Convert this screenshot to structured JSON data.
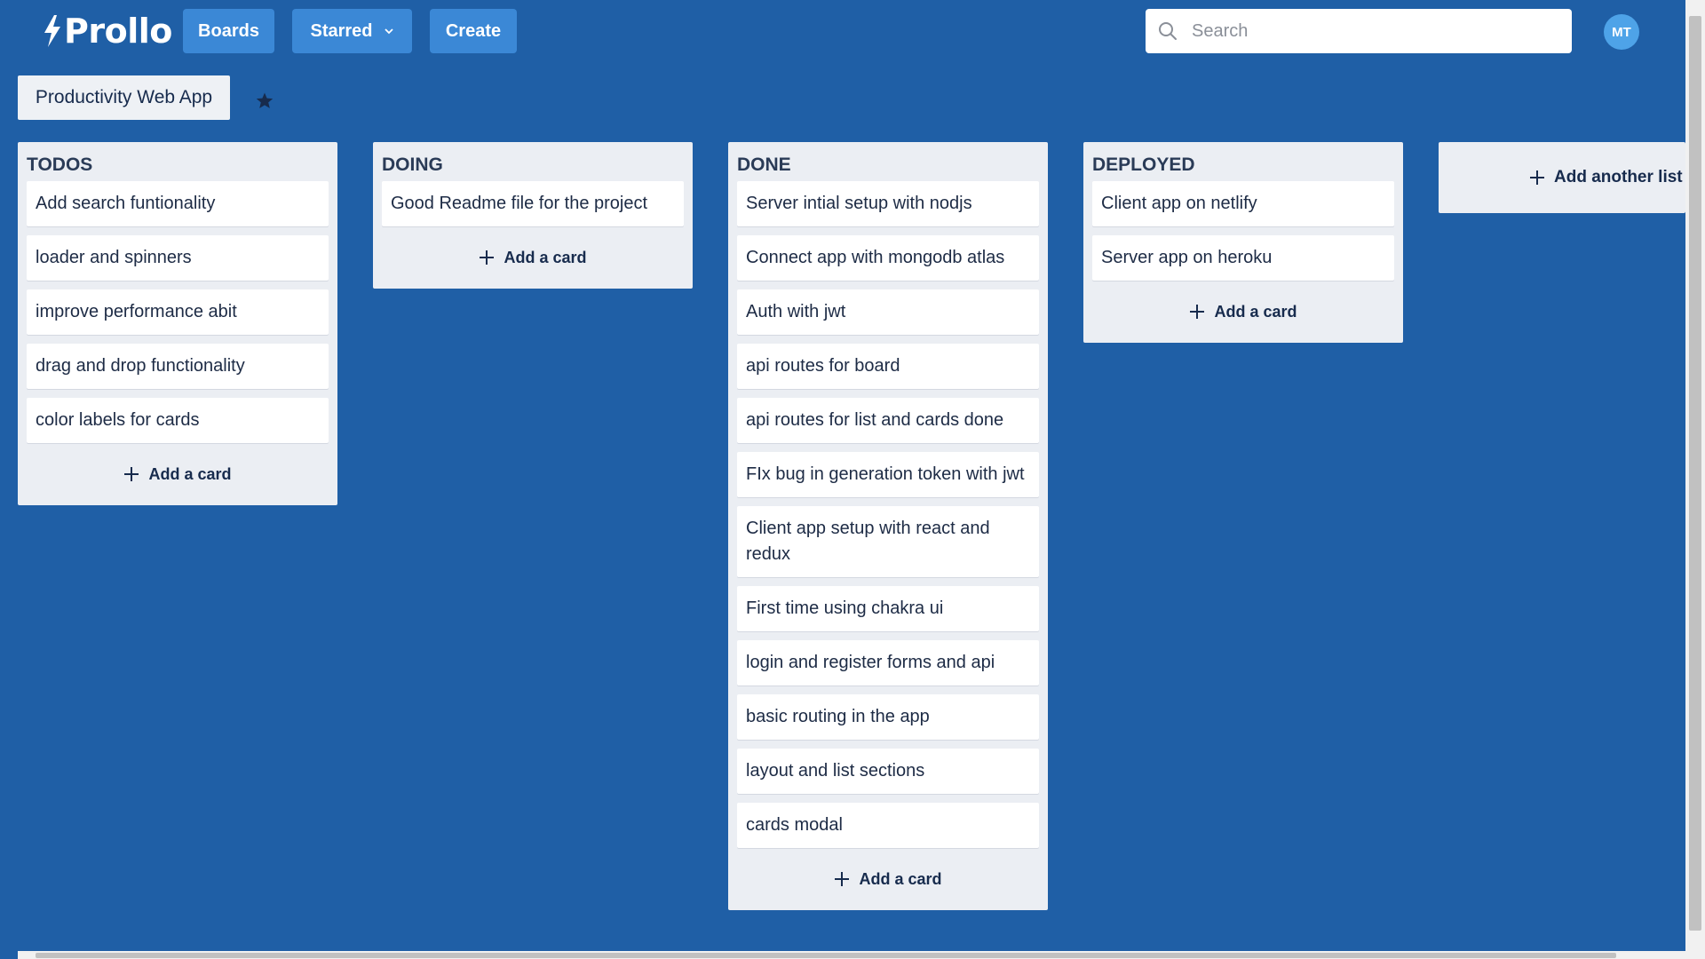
{
  "header": {
    "logo_text": "Prollo",
    "nav": {
      "boards_label": "Boards",
      "starred_label": "Starred",
      "create_label": "Create"
    },
    "search": {
      "placeholder": "Search",
      "value": ""
    },
    "user_initials": "MT"
  },
  "board": {
    "title": "Productivity Web App",
    "add_list_label": "Add another list",
    "add_card_label": "Add a card",
    "lists": [
      {
        "title": "TODOS",
        "cards": [
          "Add search funtionality",
          "loader and spinners",
          "improve performance abit",
          "drag and drop functionality",
          "color labels for cards"
        ]
      },
      {
        "title": "DOING",
        "cards": [
          "Good Readme file for the project"
        ]
      },
      {
        "title": "DONE",
        "cards": [
          "Server intial setup with nodjs",
          "Connect app with mongodb atlas",
          "Auth with jwt",
          "api routes for board",
          "api routes for list and cards done",
          "FIx bug in generation token with jwt",
          "Client app setup with react and redux",
          "First time using chakra ui",
          "login and register forms and api",
          "basic routing in the app",
          "layout and list sections",
          "cards modal"
        ]
      },
      {
        "title": "DEPLOYED",
        "cards": [
          "Client app on netlify",
          "Server app on heroku"
        ]
      }
    ]
  },
  "icons": {
    "logo": "lightning-bolt-icon",
    "starred_dropdown": "chevron-down-icon",
    "search": "search-icon",
    "board_star": "star-icon",
    "add": "plus-icon"
  },
  "colors": {
    "background": "#1f5fa6",
    "nav_button": "#3b88d6",
    "list_background": "#ebeef3",
    "avatar": "#4ea3e8"
  }
}
